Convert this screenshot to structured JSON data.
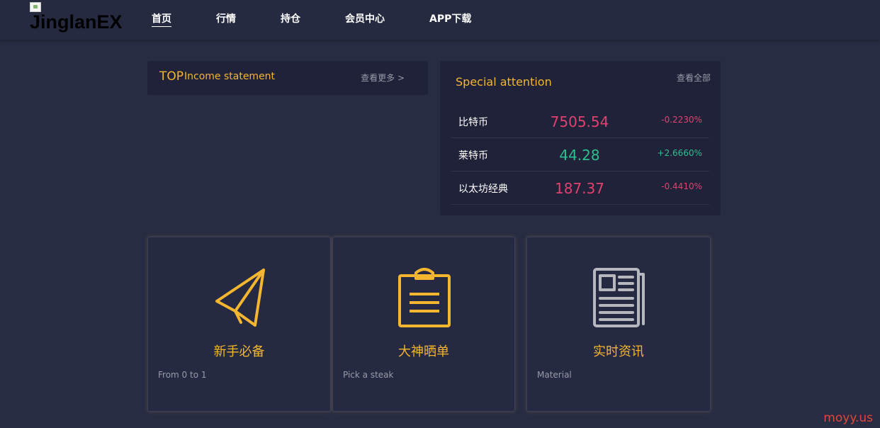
{
  "header": {
    "logo_text": "JinglanEX",
    "nav": [
      {
        "label": "首页",
        "active": true
      },
      {
        "label": "行情",
        "active": false
      },
      {
        "label": "持仓",
        "active": false
      },
      {
        "label": "会员中心",
        "active": false
      },
      {
        "label": "APP下载",
        "active": false
      }
    ]
  },
  "top_panel": {
    "tag": "TOP",
    "title": "Income statement",
    "more_label": "查看更多 >"
  },
  "special": {
    "title": "Special attention",
    "view_all_label": "查看全部",
    "rows": [
      {
        "name": "比特币",
        "price": "7505.54",
        "change": "-0.2230%",
        "trend": "down"
      },
      {
        "name": "莱特币",
        "price": "44.28",
        "change": "+2.6660%",
        "trend": "up"
      },
      {
        "name": "以太坊经典",
        "price": "187.37",
        "change": "-0.4410%",
        "trend": "down"
      }
    ]
  },
  "cards": [
    {
      "icon": "paper-plane-icon",
      "title": "新手必备",
      "subtitle": "From 0 to 1"
    },
    {
      "icon": "clipboard-icon",
      "title": "大神晒单",
      "subtitle": "Pick a steak"
    },
    {
      "icon": "newspaper-icon",
      "title": "实时资讯",
      "subtitle": "Material"
    }
  ],
  "watermark": "moyy.us",
  "colors": {
    "background": "#282c43",
    "panel": "#20223a",
    "accent": "#f5b62f",
    "negative": "#e2416f",
    "positive": "#2fbf8e"
  }
}
